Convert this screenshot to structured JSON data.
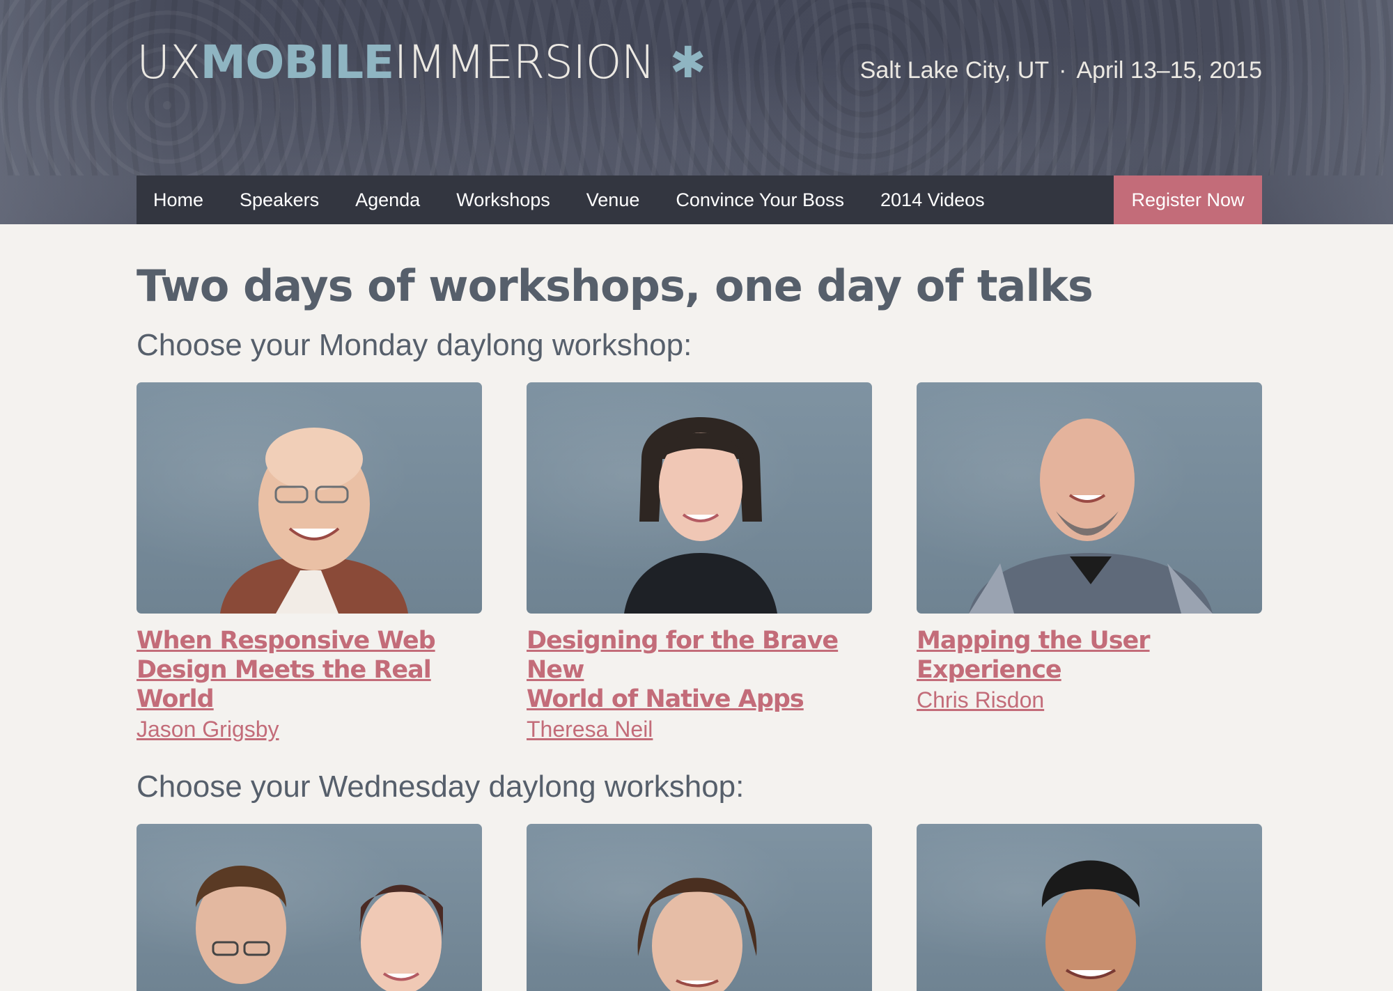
{
  "header": {
    "logo": {
      "part1": "UX",
      "part2": "MOBILE",
      "part3": "IMMERSION",
      "mark": "✱"
    },
    "location": "Salt Lake City, UT",
    "separator": "·",
    "dates": "April 13–15, 2015"
  },
  "nav": {
    "items": [
      "Home",
      "Speakers",
      "Agenda",
      "Workshops",
      "Venue",
      "Convince Your Boss",
      "2014 Videos"
    ],
    "register_label": "Register Now"
  },
  "main": {
    "title": "Two days of workshops, one day of talks",
    "monday": {
      "heading": "Choose your Monday daylong workshop:",
      "workshops": [
        {
          "title_line1": "When Responsive Web",
          "title_line2": "Design Meets the Real World",
          "speaker": "Jason Grigsby"
        },
        {
          "title_line1": "Designing for the Brave New",
          "title_line2": "World of Native Apps",
          "speaker": "Theresa Neil"
        },
        {
          "title_line1": "Mapping the User Experience",
          "title_line2": "",
          "speaker": "Chris Risdon"
        }
      ]
    },
    "wednesday": {
      "heading": "Choose your Wednesday daylong workshop:"
    }
  },
  "colors": {
    "accent": "#c36c79",
    "logo_blue": "#8fb5c2",
    "nav_bg": "#333640",
    "text": "#565f6b",
    "page_bg": "#f4f2ef"
  }
}
